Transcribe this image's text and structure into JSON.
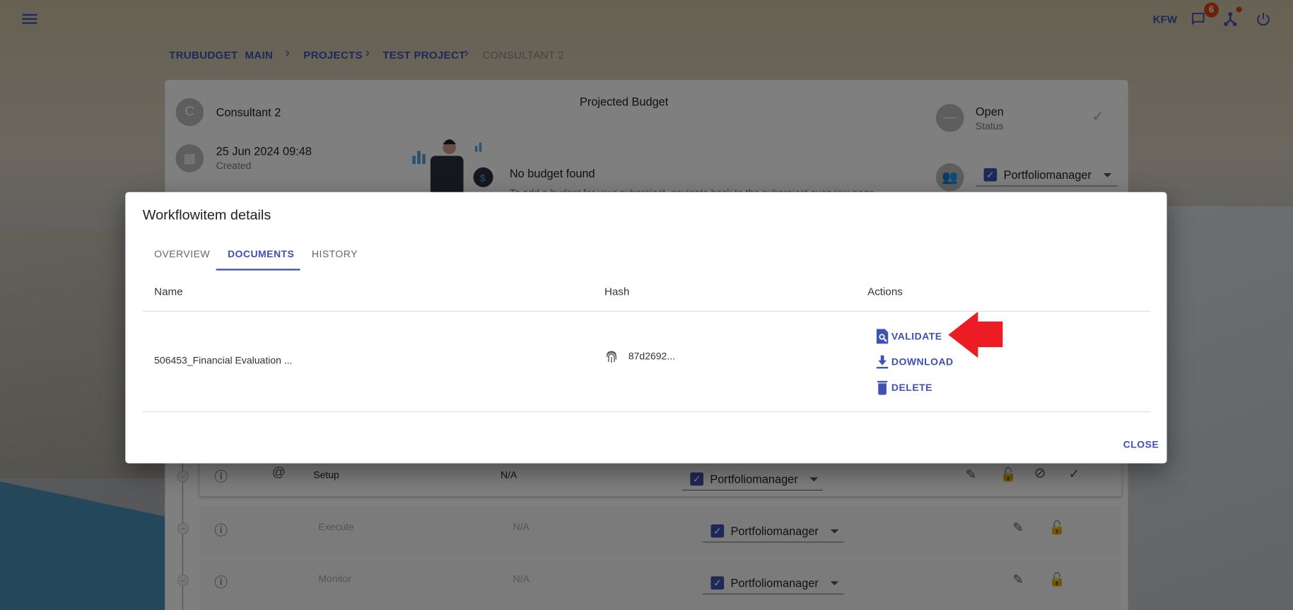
{
  "topbar": {
    "organization": "KFW",
    "notification_count": "6",
    "icons": [
      "menu-icon",
      "chat-icon",
      "network-icon",
      "power-icon"
    ]
  },
  "breadcrumb": [
    {
      "label": "TRUBUDGET"
    },
    {
      "label": "MAIN"
    },
    {
      "label": "PROJECTS"
    },
    {
      "label": "TEST PROJECT"
    },
    {
      "label": "CONSULTANT 2"
    }
  ],
  "subproject": {
    "avatar_letter": "C",
    "name": "Consultant 2",
    "created_date": "25 Jun 2024 09:48",
    "created_label": "Created",
    "budget_title": "Projected Budget",
    "no_budget": "No budget found",
    "no_budget_hint": "To add a budget for your subproject, navigate back to the subproject overview page.",
    "status_value": "Open",
    "status_label": "Status",
    "assignee": "Portfoliomanager"
  },
  "workflowitems": [
    {
      "name": "Setup",
      "amount": "N/A",
      "assignee": "Portfoliomanager",
      "disabled": false
    },
    {
      "name": "Execute",
      "amount": "N/A",
      "assignee": "Portfoliomanager",
      "disabled": true
    },
    {
      "name": "Monitor",
      "amount": "N/A",
      "assignee": "Portfoliomanager",
      "disabled": true
    }
  ],
  "dialog": {
    "title": "Workflowitem details",
    "tabs": [
      {
        "label": "OVERVIEW"
      },
      {
        "label": "DOCUMENTS",
        "active": true
      },
      {
        "label": "HISTORY"
      }
    ],
    "columns": {
      "name": "Name",
      "hash": "Hash",
      "actions": "Actions"
    },
    "documents": [
      {
        "name": "506453_Financial Evaluation ...",
        "hash": "87d2692..."
      }
    ],
    "actions": {
      "validate": "VALIDATE",
      "download": "DOWNLOAD",
      "delete": "DELETE"
    },
    "close_label": "CLOSE"
  },
  "colors": {
    "primary": "#3f51b5",
    "annotation_arrow": "#ed1c24",
    "badge": "#d84315"
  }
}
